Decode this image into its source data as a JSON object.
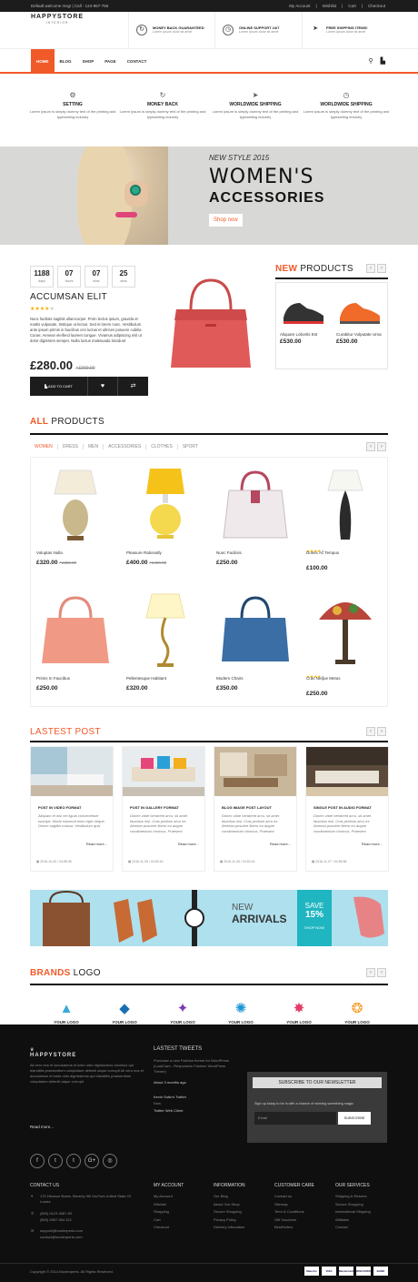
{
  "topbar": {
    "welcome": "Default welcome msg! | Call - 124-957-756",
    "links": [
      "My Account",
      "Wishlist",
      "Cart",
      "Checkout"
    ]
  },
  "logo": {
    "name": "HAPPYSTORE",
    "tagline": "INTERIOR"
  },
  "features": [
    {
      "title": "MONEY BACK GUARANTEED",
      "text": "Lorem ipsum dolor sit amet",
      "icon": "refresh-icon"
    },
    {
      "title": "ONLINE SUPPORT 24/7",
      "text": "Lorem ipsum dolor sit amet",
      "icon": "clock-icon"
    },
    {
      "title": "FREE SHIPPING ITEMS!",
      "text": "Lorem ipsum dolor sit amet",
      "icon": "plane-icon"
    }
  ],
  "nav": {
    "items": [
      "HOME",
      "BLOG",
      "SHOP",
      "PAGE",
      "CONTACT"
    ],
    "active": "HOME"
  },
  "services": [
    {
      "title": "SETTING",
      "text": "Lorem Ipsum is simply dummy text of the printing and typesetting industry",
      "icon": "gear-icon"
    },
    {
      "title": "MONEY BACK",
      "text": "Lorem Ipsum is simply dummy text of the printing and typesetting industry",
      "icon": "refresh-icon"
    },
    {
      "title": "WORLDWIDE SHIPPING",
      "text": "Lorem Ipsum is simply dummy text of the printing and typesetting industry",
      "icon": "plane-icon"
    },
    {
      "title": "WORLDWIDE SHIPPING",
      "text": "Lorem Ipsum is simply dummy text of the printing and typesetting industry",
      "icon": "clock-icon"
    }
  ],
  "banner": {
    "kicker": "NEW STYLE 2015",
    "title": "WOMEN'S",
    "subtitle": "ACCESSORIES",
    "button": "Shop now"
  },
  "deal": {
    "countdown": [
      {
        "n": "1188",
        "u": "days"
      },
      {
        "n": "07",
        "u": "hours"
      },
      {
        "n": "07",
        "u": "mins"
      },
      {
        "n": "25",
        "u": "secs"
      }
    ],
    "title": "ACCUMSAN ELIT",
    "rating": 4,
    "desc": "Nunc facilisis sagittis ullamcorper. Proin lectus ipsum, gravida et mattis vulputate, tristique ut lectus. Sed et lorem nunc. Vestibulum ante ipsum primis in faucibus orci luctus et ultrices posuere cubilia Curae; Aenean eleifend laoreet congue. Vivamus adipiscing nisl ut dolor dignissim semper. Nulla luctus malesuada tincidunt",
    "price": "£280.00",
    "old": "/ £300.00",
    "add": "ADD TO CART"
  },
  "new_products": {
    "title_accent": "NEW",
    "title_rest": " PRODUCTS",
    "items": [
      {
        "name": "Aliquam Lobortis Est",
        "price": "£530.00"
      },
      {
        "name": "Curabitur Vulputate Urna",
        "price": "£530.00"
      }
    ]
  },
  "all_products": {
    "title_accent": "ALL",
    "title_rest": " PRODUCTS",
    "tabs": [
      "WOMEN",
      "DRESS",
      "MEN",
      "ACCESSORIES",
      "CLOTHES",
      "SPORT"
    ],
    "items": [
      {
        "name": "Voluptas Nulla",
        "price": "£320.00",
        "old": "/ £355.00",
        "stars": 0
      },
      {
        "name": "Pleasure Rationally",
        "price": "£400.00",
        "old": "/ £480.00",
        "stars": 0
      },
      {
        "name": "Nunc Facilisis",
        "price": "£250.00",
        "old": "",
        "stars": 0
      },
      {
        "name": "Donec Ac Tempus",
        "price": "£100.00",
        "old": "",
        "stars": 4
      },
      {
        "name": "Primis In Faucibus",
        "price": "£250.00",
        "old": "",
        "stars": 0
      },
      {
        "name": "Pellentesque Habitant",
        "price": "£320.00",
        "old": "",
        "stars": 0
      },
      {
        "name": "Modern Chairs",
        "price": "£350.00",
        "old": "",
        "stars": 0
      },
      {
        "name": "Cras Neque Metus",
        "price": "£250.00",
        "old": "",
        "stars": 4
      }
    ]
  },
  "posts": {
    "title": "LASTEST POST",
    "items": [
      {
        "title": "POST IN VIDEO FORMAT",
        "text": "Aliquam et nisl vel ligula consectetuer suscipit. Morbi euismod enim eget neque. Donec sagittis massa. Vestibulum quis",
        "date": "2016-10-30 / 04:55:35"
      },
      {
        "title": "POST IN GALLERY FORMAT",
        "text": "Donec vitae hendrerit arcu, sit amet faucibus nisl. Cras pretium arcu ex. Aenean posuere libero eu augue condimentum rhoncus. Praesent",
        "date": "2016-11-05 / 04:53:16"
      },
      {
        "title": "BLOG IMAGE POST LAYOUT",
        "text": "Donec vitae hendrerit arcu, sit amet faucibus nisl. Cras pretium arcu ex. Aenean posuere libero eu augue condimentum rhoncus. Praesent",
        "date": "2016-11-05 / 04:53:16"
      },
      {
        "title": "SINGLE POST IN AUDIO FORMAT",
        "text": "Donec vitae hendrerit arcu, sit amet faucibus nisl. Cras pretium arcu ex. Aenean posuere libero eu augue condimentum rhoncus. Praesent",
        "date": "2016-11-07 / 04:55:56"
      }
    ],
    "more": "Read more..."
  },
  "arrivals": {
    "new": "NEW",
    "title": "ARRIVALS",
    "save": "SAVE",
    "pct": "15%",
    "shop": "SHOP NOW"
  },
  "brands": {
    "title_accent": "BRANDS",
    "title_rest": " LOGO",
    "label": "YOUR LOGO"
  },
  "footer": {
    "about": "Ali vero eos et accusamus et iusto odio dignissimos ducimus qui blanditiis praesentium voluptatum deleniti atque corrupti Ali vero eos et accusamus et iusto odio dignissimos qui blanditiis praesentium voluptatum deleniti atque corrupti",
    "read_more": "Read more...",
    "tweets_title": "LASTEST TWEETS",
    "tweet": "Purchase a new Fashion theme for WordPress (LookCare - Responsive Fashion WordPress Theme)",
    "tweet_time": "About 3 months ago",
    "tweet2": "Kevin Sotto's Twitter",
    "tweet2_time": "Now",
    "tweet3": "Twitter Web Client",
    "news_title": "SUBSCRIBE TO OUR NEWSLETTER",
    "news_text": "Sign up today to be in with a chance of winning something magic",
    "news_placeholder": "Email",
    "news_btn": "SUBSCRIBE",
    "social": [
      "f",
      "t",
      "t",
      "G+",
      "◎"
    ],
    "contact_title": "CONTACT US",
    "address": "170 Hewson Braes, Beverly Hill Ga/York United State Of Lowes",
    "phone1": "(800) 0123 4567 89",
    "phone2": "(800) 0987 654 321",
    "email1": "support@bootexperts.com",
    "email2": "contact@bootexperts.com",
    "cols": [
      {
        "title": "MY ACCOUNT",
        "items": [
          "My Account",
          "Wishlist",
          "Shopping",
          "Cart",
          "Checkout"
        ]
      },
      {
        "title": "INFORMATION",
        "items": [
          "Our Blog",
          "About Our Shop",
          "Secure Shopping",
          "Privacy Policy",
          "Delivery Infomation"
        ]
      },
      {
        "title": "CUSTOMER CARE",
        "items": [
          "Contact us",
          "Sitemap",
          "Term & Conditions",
          "Gift Vouchers",
          "BestSellers"
        ]
      },
      {
        "title": "OUR SERVICES",
        "items": [
          "Shipping & Returns",
          "Secure Shopping",
          "International Shipping",
          "Affiliates",
          "Contact"
        ]
      }
    ],
    "copyright": "Copyright © 2014 Bootexperts. All Rights Reserved.",
    "payments": [
      "Maestro",
      "VISA",
      "Mastercard",
      "DISCOVER",
      "BANK"
    ]
  },
  "colors": {
    "accent": "#f05a28",
    "dark": "#111111"
  }
}
